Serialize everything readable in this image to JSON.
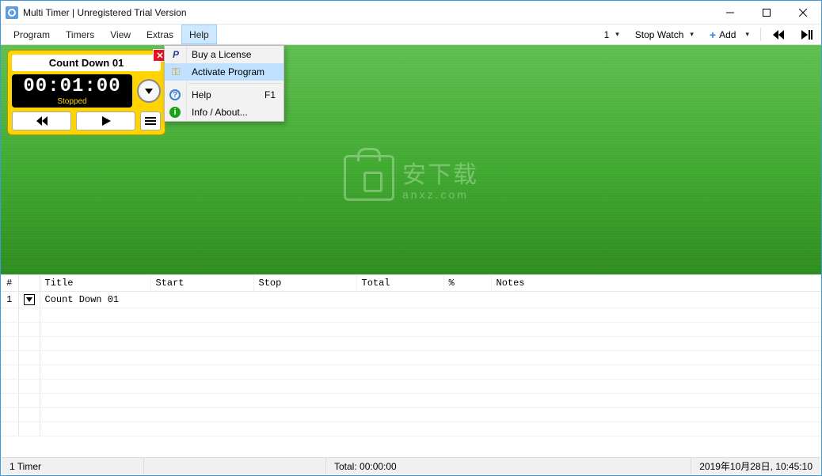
{
  "window": {
    "title": "Multi Timer | Unregistered Trial Version"
  },
  "menubar": {
    "program": "Program",
    "timers": "Timers",
    "view": "View",
    "extras": "Extras",
    "help": "Help"
  },
  "toolbar": {
    "count": "1",
    "mode": "Stop Watch",
    "add": "Add"
  },
  "help_menu": {
    "buy": "Buy a License",
    "activate": "Activate Program",
    "help": "Help",
    "help_key": "F1",
    "about": "Info / About..."
  },
  "timer": {
    "title": "Count Down 01",
    "time": "00:01:00",
    "status": "Stopped"
  },
  "watermark": {
    "line1": "安下载",
    "line2": "anxz.com"
  },
  "grid": {
    "headers": {
      "num": "#",
      "title": "Title",
      "start": "Start",
      "stop": "Stop",
      "total": "Total",
      "pct": "%",
      "notes": "Notes"
    },
    "rows": [
      {
        "num": "1",
        "title": "Count Down 01",
        "start": "",
        "stop": "",
        "total": "",
        "pct": "",
        "notes": ""
      }
    ]
  },
  "status": {
    "left": "1 Timer",
    "center": "Total: 00:00:00",
    "right": "2019年10月28日, 10:45:10"
  }
}
